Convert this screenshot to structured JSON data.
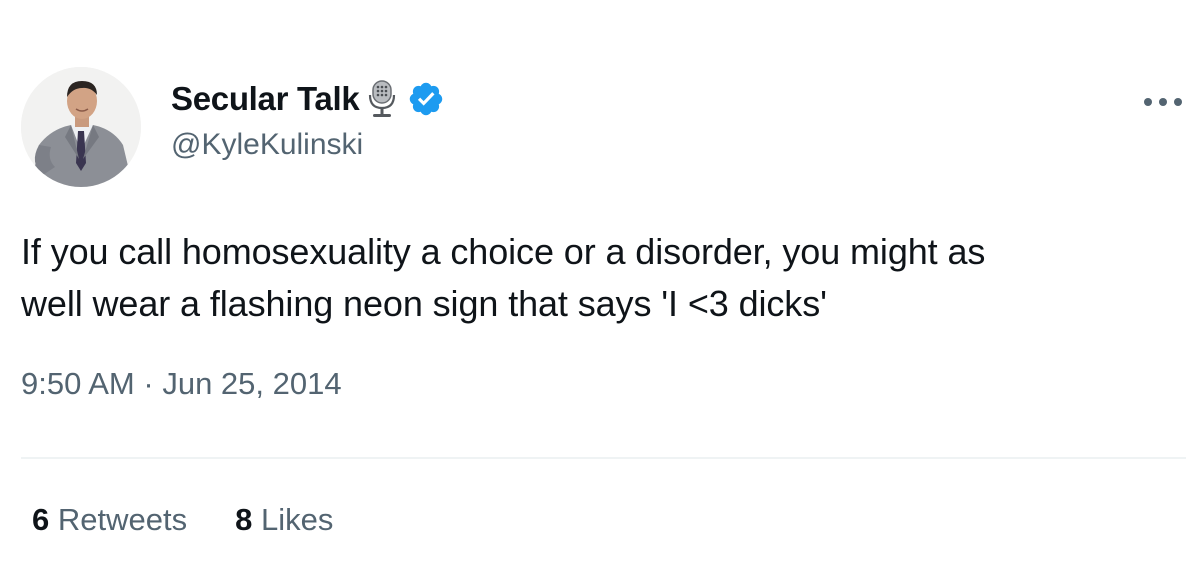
{
  "author": {
    "display_name": "Secular Talk",
    "handle": "@KyleKulinski",
    "verified": true,
    "name_emoji": "studio-microphone-icon"
  },
  "tweet": {
    "text_lines": [
      "If you call homosexuality a choice or a disorder, you might as",
      "well wear a flashing neon sign that says 'I <3 dicks'"
    ],
    "time": "9:50 AM",
    "separator": "·",
    "date": "Jun 25, 2014"
  },
  "stats": {
    "retweets_count": "6",
    "retweets_label": "Retweets",
    "likes_count": "8",
    "likes_label": "Likes"
  },
  "colors": {
    "text_primary": "#0f1419",
    "text_secondary": "#536471",
    "verified_blue": "#1d9bf0",
    "divider": "#eff3f4"
  }
}
